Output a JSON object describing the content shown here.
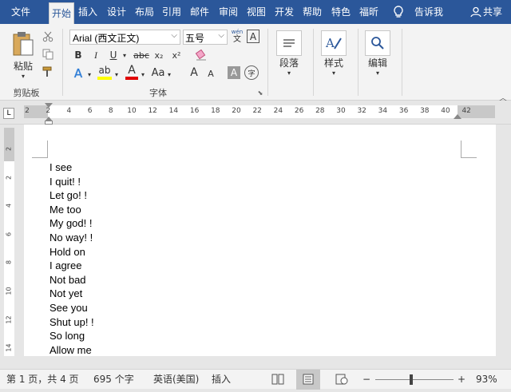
{
  "tabs": [
    "文件",
    "开始",
    "插入",
    "设计",
    "布局",
    "引用",
    "邮件",
    "审阅",
    "视图",
    "开发",
    "帮助",
    "特色",
    "福昕",
    "告诉我",
    "共享"
  ],
  "active_tab": "开始",
  "ribbon": {
    "paste_label": "粘贴",
    "clipboard_label": "剪贴板",
    "font_name": "Arial (西文正文)",
    "font_size": "五号",
    "phonetic_top": "wén",
    "phonetic_bottom": "文",
    "char_border": "A",
    "bold": "B",
    "italic": "I",
    "underline": "U",
    "strikethrough": "abc",
    "subscript": "x₂",
    "superscript": "x²",
    "font_group_label": "字体",
    "text_effects": "A",
    "highlight": "ab",
    "font_color": "A",
    "change_case": "Aa",
    "grow_font": "A",
    "shrink_font": "A",
    "char_shading": "A",
    "enclose_char": "字",
    "paragraph_label": "段落",
    "styles_label": "样式",
    "editing_label": "编辑"
  },
  "ruler_ticks": [
    "2",
    "2",
    "4",
    "6",
    "8",
    "10",
    "12",
    "14",
    "16",
    "18",
    "20",
    "22",
    "24",
    "26",
    "28",
    "30",
    "32",
    "34",
    "36",
    "38",
    "40",
    "42"
  ],
  "vruler_ticks": [
    "2",
    "2",
    "4",
    "6",
    "8",
    "10",
    "12",
    "14"
  ],
  "document": {
    "lines": [
      "I see",
      "I quit! !",
      "Let go! !",
      "Me too",
      "My god! !",
      "No way! !",
      "Hold on",
      "I agree",
      "Not bad",
      "Not yet",
      "See you",
      "Shut up! !",
      "So long",
      "Allow me"
    ]
  },
  "status": {
    "page": "第 1 页，共 4 页",
    "words": "695 个字",
    "language": "英语(美国)",
    "insert_mode": "插入",
    "zoom_minus": "−",
    "zoom_plus": "+",
    "zoom": "93%"
  },
  "colors": {
    "titlebar": "#2b579a",
    "highlight": "#ffff00",
    "font_color": "#e00000"
  },
  "icons": [
    "cut-icon",
    "copy-icon",
    "format-painter-icon",
    "clear-format-icon",
    "paragraph-icon",
    "styles-icon",
    "editing-icon",
    "lightbulb-icon",
    "user-icon",
    "read-mode-icon",
    "print-layout-icon",
    "web-layout-icon"
  ]
}
